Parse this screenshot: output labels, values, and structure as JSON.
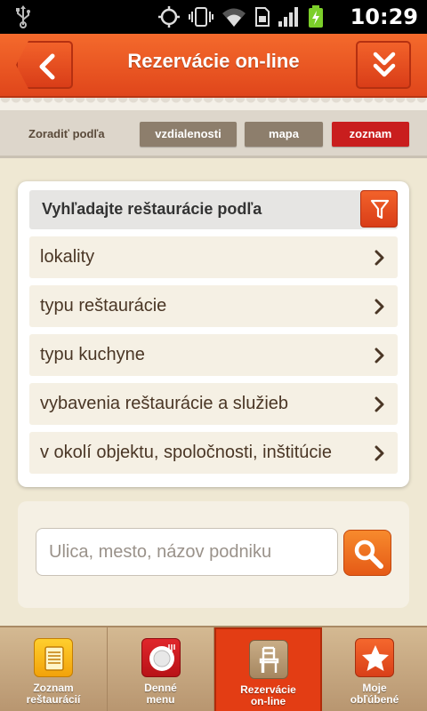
{
  "status_bar": {
    "time": "10:29",
    "icons": [
      "usb-icon",
      "gps-icon",
      "vibrate-icon",
      "wifi-icon",
      "sim-icon",
      "signal-icon",
      "battery-charging-icon"
    ]
  },
  "header": {
    "title": "Rezervácie on-line",
    "back_icon": "chevron-left-icon",
    "menu_icon": "double-chevron-down-icon"
  },
  "sort": {
    "label": "Zoradiť podľa",
    "options": [
      "vzdialenosti",
      "mapa",
      "zoznam"
    ],
    "selected": "zoznam",
    "colors": {
      "default": "#8d7e6c",
      "selected": "#c91e1e"
    }
  },
  "filter_card": {
    "title": "Vyhľadajte reštaurácie podľa",
    "items": [
      {
        "label": "lokality"
      },
      {
        "label": "typu reštaurácie"
      },
      {
        "label": "typu kuchyne"
      },
      {
        "label": "vybavenia reštaurácie a služieb"
      },
      {
        "label": "v okolí objektu, spoločnosti, inštitúcie"
      }
    ]
  },
  "search": {
    "placeholder": "Ulica, mesto, názov podniku",
    "value": ""
  },
  "tabs": [
    {
      "label_line1": "Zoznam",
      "label_line2": "reštaurácií",
      "icon": "list-icon",
      "active": false
    },
    {
      "label_line1": "Denné",
      "label_line2": "menu",
      "icon": "plate-icon",
      "active": false
    },
    {
      "label_line1": "Rezervácie",
      "label_line2": "on-line",
      "icon": "chair-icon",
      "active": true
    },
    {
      "label_line1": "Moje",
      "label_line2": "obľúbené",
      "icon": "star-icon",
      "active": false
    }
  ],
  "colors": {
    "accent": "#e0461b",
    "background": "#efe8d3",
    "tab_active": "#e33d14"
  }
}
